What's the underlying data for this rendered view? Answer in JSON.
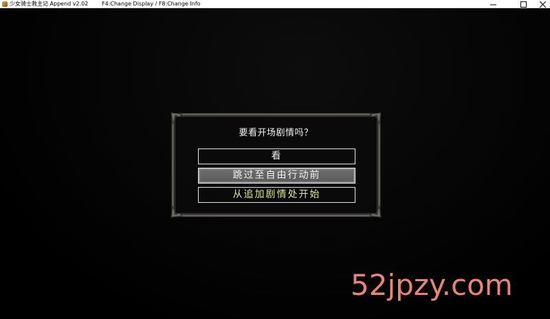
{
  "window": {
    "title": "少女骑士救主记  Append v2.02",
    "hotkeys": "F4:Change Display / F8:Change Info",
    "controls": {
      "minimize": "─",
      "maximize": "☐",
      "close": "✕"
    }
  },
  "dialog": {
    "prompt": "要看开场剧情吗？",
    "choices": [
      {
        "label": "看",
        "selected": false
      },
      {
        "label": "跳过至自由行动前",
        "selected": true
      },
      {
        "label": "从追加剧情处开始",
        "selected": false
      }
    ]
  },
  "watermark": {
    "text": "52jpzy.com"
  },
  "colors": {
    "background": "#000000",
    "dialog_border": "#5c5c54",
    "selected_choice": "#646464",
    "third_choice_text": "#d4e98a",
    "watermark": "#ea8576"
  }
}
